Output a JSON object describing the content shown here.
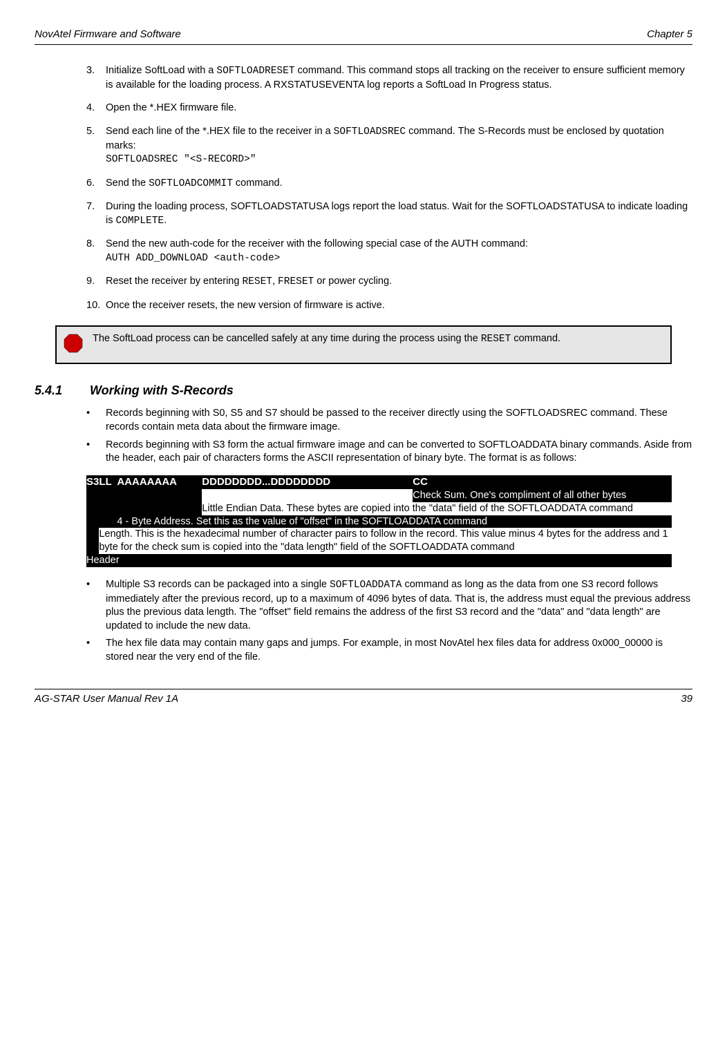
{
  "header": {
    "left": "NovAtel Firmware and Software",
    "right": "Chapter 5"
  },
  "steps": [
    {
      "num": "3.",
      "segments": [
        {
          "t": "Initialize SoftLoad with a "
        },
        {
          "t": "SOFTLOADRESET",
          "mono": true
        },
        {
          "t": " command. This command stops all tracking on the receiver to ensure sufficient memory is available for the loading process. A RXSTATUSEVENTA log reports a SoftLoad In Progress status."
        }
      ]
    },
    {
      "num": "4.",
      "segments": [
        {
          "t": "Open the *.HEX firmware file."
        }
      ]
    },
    {
      "num": "5.",
      "segments": [
        {
          "t": "Send each line of the *.HEX file to the receiver in a "
        },
        {
          "t": "SOFTLOADSREC",
          "mono": true
        },
        {
          "t": " command. The S-Records must be enclosed by quotation marks:"
        },
        {
          "br": true
        },
        {
          "t": "SOFTLOADSREC \"<S-RECORD>\"",
          "mono": true
        }
      ]
    },
    {
      "num": "6.",
      "segments": [
        {
          "t": "Send the "
        },
        {
          "t": "SOFTLOADCOMMIT",
          "mono": true
        },
        {
          "t": " command."
        }
      ]
    },
    {
      "num": "7.",
      "segments": [
        {
          "t": "During the loading process, SOFTLOADSTATUSA logs report the load status. Wait for the SOFTLOADSTATUSA to indicate loading is "
        },
        {
          "t": "COMPLETE",
          "mono": true
        },
        {
          "t": "."
        }
      ]
    },
    {
      "num": "8.",
      "segments": [
        {
          "t": "Send the new auth-code for the receiver with the following special case of the AUTH command:"
        },
        {
          "br": true
        },
        {
          "t": "AUTH ADD_DOWNLOAD <auth-code>",
          "mono": true
        }
      ]
    },
    {
      "num": "9.",
      "segments": [
        {
          "t": "Reset the receiver by entering "
        },
        {
          "t": "RESET",
          "mono": true
        },
        {
          "t": ", "
        },
        {
          "t": "FRESET",
          "mono": true
        },
        {
          "t": " or power cycling."
        }
      ]
    },
    {
      "num": "10.",
      "segments": [
        {
          "t": "Once the receiver resets, the new version of firmware is active."
        }
      ]
    }
  ],
  "note": {
    "segments": [
      {
        "t": "The SoftLoad process can be cancelled safely at any time during the process using the "
      },
      {
        "t": "RESET",
        "mono": true
      },
      {
        "t": " command."
      }
    ]
  },
  "section": {
    "num": "5.4.1",
    "title": "Working with S-Records"
  },
  "bullets_top": [
    {
      "segments": [
        {
          "t": "Records beginning with S0, S5 and S7 should be passed to the receiver directly using the SOFTLOADSREC command. These records contain meta data about the firmware image."
        }
      ]
    },
    {
      "segments": [
        {
          "t": "Records beginning with S3 form the actual firmware image and can be converted to SOFTLOADDATA binary commands. Aside from the header, each pair of characters forms the ASCII representation of binary byte. The format is as follows:"
        }
      ]
    }
  ],
  "srec": {
    "headers": {
      "s3": "S3",
      "ll": "LL",
      "aa": "AAAAAAAA",
      "dd": "DDDDDDDD...DDDDDDDD",
      "cc": "CC"
    },
    "cc_desc": "Check Sum. One's compliment of all other bytes",
    "dd_desc": "Little Endian Data. These bytes are copied into the \"data\" field of the SOFTLOADDATA command",
    "aa_desc": "4 - Byte Address. Set this as the value of \"offset\" in the SOFTLOADDATA command",
    "ll_desc": "Length. This is the hexadecimal number of character pairs to follow in the record. This value minus 4 bytes for the address and 1 byte for the check sum is copied into the \"data length\" field of the SOFTLOADDATA command",
    "s3_desc": "Header"
  },
  "bullets_bottom": [
    {
      "segments": [
        {
          "t": "Multiple S3 records can be packaged into a single "
        },
        {
          "t": "SOFTLOADDATA",
          "mono": true
        },
        {
          "t": " command as long as the data from one S3 record follows immediately after the previous record, up to a maximum of 4096 bytes of data. That is, the address must equal the previous address plus the previous data length. The \"offset\" field remains the address of the first S3 record and the \"data\" and \"data length\" are updated to include the new data."
        }
      ]
    },
    {
      "segments": [
        {
          "t": "The hex file data may contain many gaps and jumps. For example, in most NovAtel hex files data for address 0x000_00000 is stored near the very end of the file."
        }
      ]
    }
  ],
  "footer": {
    "left": "AG-STAR User Manual Rev 1A",
    "right": "39"
  }
}
